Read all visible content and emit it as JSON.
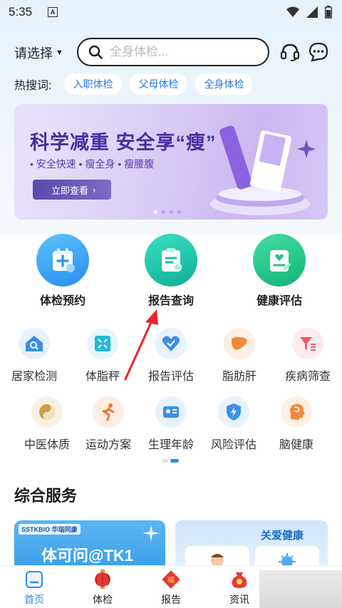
{
  "status_bar": {
    "time": "5:35",
    "notification_icon": "a-letter-icon",
    "icons": [
      "wifi-icon",
      "signal-icon",
      "battery-icon"
    ]
  },
  "header": {
    "selector_label": "请选择",
    "search_placeholder": "全身体检...",
    "icons": [
      "headset-icon",
      "chat-icon"
    ]
  },
  "hot_search": {
    "label": "热搜词:",
    "chips": [
      "入职体检",
      "父母体检",
      "全身体检"
    ]
  },
  "banner": {
    "title": "科学减重 安全享“瘦”",
    "subtitle": "• 安全快速 • 瘦全身 • 瘦腰腹",
    "cta": "立即查看",
    "page_count": 4,
    "active_index": 0
  },
  "main_entries": [
    {
      "label": "体检预约",
      "icon": "calendar-plus-icon",
      "color": "#2e9cf0"
    },
    {
      "label": "报告查询",
      "icon": "clipboard-search-icon",
      "color": "#14c0a6"
    },
    {
      "label": "健康评估",
      "icon": "heart-clipboard-icon",
      "color": "#1fc48a"
    }
  ],
  "grid_page": {
    "row1": [
      {
        "label": "居家检测",
        "icon": "home-search-icon",
        "color": "#3b8fe8",
        "bg": "#e8f2fd"
      },
      {
        "label": "体脂秤",
        "icon": "scale-icon",
        "color": "#26b9d8",
        "bg": "#e4f7fb"
      },
      {
        "label": "报告评估",
        "icon": "heart-check-icon",
        "color": "#3b8fe8",
        "bg": "#e8f2fd"
      },
      {
        "label": "脂肪肝",
        "icon": "liver-icon",
        "color": "#f08a3a",
        "bg": "#fdefe3"
      },
      {
        "label": "疾病筛查",
        "icon": "filter-icon",
        "color": "#ee5a6a",
        "bg": "#fdebee"
      }
    ],
    "row2": [
      {
        "label": "中医体质",
        "icon": "yin-yang-icon",
        "color": "#c9a14c",
        "bg": "#f8f1e2"
      },
      {
        "label": "运动方案",
        "icon": "running-icon",
        "color": "#f07a3a",
        "bg": "#fdeee3"
      },
      {
        "label": "生理年龄",
        "icon": "id-card-icon",
        "color": "#3b8fe8",
        "bg": "#e8f2fd"
      },
      {
        "label": "风险评估",
        "icon": "shield-bolt-icon",
        "color": "#3b8fe8",
        "bg": "#e8f2fd"
      },
      {
        "label": "脑健康",
        "icon": "brain-head-icon",
        "color": "#f08a3a",
        "bg": "#fdefe3"
      }
    ],
    "page_count": 2,
    "active_index": 1
  },
  "services": {
    "title": "综合服务",
    "card_left": {
      "logo": "SSTKBIO 华瑞同康",
      "title": "体可问@TK1"
    },
    "card_right": {
      "title": "关爱健康"
    }
  },
  "tab_bar": [
    {
      "label": "首页",
      "icon": "home-icon",
      "active": true
    },
    {
      "label": "体检",
      "icon": "lantern-icon",
      "active": false
    },
    {
      "label": "报告",
      "icon": "fu-icon",
      "active": false
    },
    {
      "label": "资讯",
      "icon": "lucky-bag-icon",
      "active": false
    }
  ],
  "colors": {
    "accent": "#2b8ee6",
    "annotation_arrow": "#e8262a"
  }
}
